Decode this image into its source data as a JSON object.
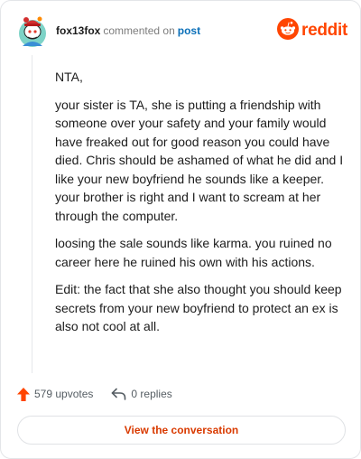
{
  "header": {
    "username": "fox13fox",
    "action_text": "commented on",
    "post_link": "post",
    "brand": "reddit"
  },
  "comment": {
    "paragraphs": [
      "NTA,",
      "your sister is TA, she is putting a friendship with someone over your safety and your family would have freaked out for good reason you could have died. Chris should be ashamed of what he did and I like your new boyfriend he sounds like a keeper. your brother is right and I want to scream at her through the computer.",
      "loosing the sale sounds like karma. you ruined no career here he ruined his own with his actions.",
      "Edit: the fact that she also thought you should keep secrets from your new boyfriend to protect an ex is also not cool at all."
    ]
  },
  "actions": {
    "upvotes": "579 upvotes",
    "replies": "0 replies"
  },
  "cta": {
    "label": "View the conversation"
  },
  "colors": {
    "accent": "#ff4500",
    "link": "#0a6fb8",
    "cta_text": "#d93a00"
  },
  "icons": [
    "snoo-avatar-icon",
    "reddit-logo-icon",
    "upvote-arrow-icon",
    "reply-arrow-icon"
  ]
}
